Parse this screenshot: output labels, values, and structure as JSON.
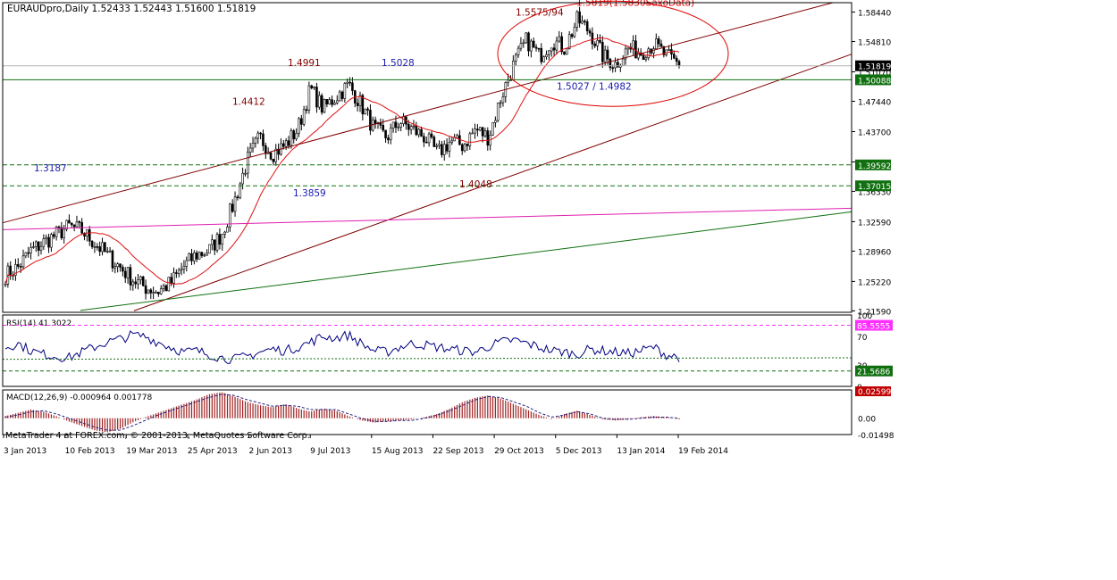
{
  "window": {
    "symbol_line": "EURAUDpro,Daily  1.52433 1.52443 1.51600 1.51819",
    "footer": "MetaTrader 4 at FOREX.com, © 2001-2013, MetaQuotes Software Corp."
  },
  "colors": {
    "background": "#ffffff",
    "candles": "#000000",
    "moving_average": "#e01010",
    "channel": "#800000",
    "pink_line": "#e020b0",
    "green_line": "#107010",
    "label_blue": "#1a1ab0",
    "label_dark_red": "#800000",
    "label_red": "#e00000",
    "badge_black": "#000000",
    "badge_green": "#107010",
    "badge_pink": "#ff30ff",
    "badge_red": "#c00000",
    "rsi_line": "#000080",
    "macd_hist": "#a02020"
  },
  "chart_data": [
    {
      "type": "candlestick",
      "panel": "price",
      "y_ticks": [
        "1.58440",
        "1.54810",
        "1.51070",
        "1.47440",
        "1.43700",
        "1.39960",
        "1.36330",
        "1.32590",
        "1.28960",
        "1.25220",
        "1.21590"
      ],
      "ylim": [
        1.2141,
        1.596
      ],
      "x_ticks": [
        "3 Jan 2013",
        "10 Feb 2013",
        "19 Mar 2013",
        "25 Apr 2013",
        "2 Jun 2013",
        "9 Jul 2013",
        "15 Aug 2013",
        "22 Sep 2013",
        "29 Oct 2013",
        "5 Dec 2013",
        "13 Jan 2014",
        "19 Feb 2014"
      ],
      "current_price": "1.51819",
      "price_badges": [
        {
          "label": "1.51819",
          "value": 1.51819,
          "style": "black"
        },
        {
          "label": "1.50088",
          "value": 1.50088,
          "style": "green"
        },
        {
          "label": "1.39592",
          "value": 1.39592,
          "style": "green"
        },
        {
          "label": "1.37015",
          "value": 1.37015,
          "style": "green"
        }
      ],
      "horizontal_levels": [
        {
          "value": 1.50088,
          "style": "solid"
        },
        {
          "value": 1.39592,
          "style": "dashed"
        },
        {
          "value": 1.37015,
          "style": "dashed"
        }
      ],
      "annotations": [
        {
          "text": "1.4991",
          "color": "dark_red"
        },
        {
          "text": "1.5028",
          "color": "blue"
        },
        {
          "text": "1.4412",
          "color": "dark_red"
        },
        {
          "text": "1.3187",
          "color": "blue"
        },
        {
          "text": "1.3859",
          "color": "blue"
        },
        {
          "text": "1.4048",
          "color": "dark_red"
        },
        {
          "text": "1.5575/94",
          "color": "dark_red"
        },
        {
          "text": "1.5819(1.5830SaxoData)",
          "color": "red"
        },
        {
          "text": "1.5027 / 1.4982",
          "color": "blue"
        }
      ],
      "close_trajectory": [
        1.26,
        1.27,
        1.29,
        1.3,
        1.31,
        1.32,
        1.315,
        1.3,
        1.285,
        1.27,
        1.255,
        1.245,
        1.24,
        1.25,
        1.27,
        1.285,
        1.29,
        1.31,
        1.35,
        1.4,
        1.43,
        1.41,
        1.42,
        1.44,
        1.49,
        1.465,
        1.48,
        1.495,
        1.47,
        1.44,
        1.43,
        1.45,
        1.44,
        1.43,
        1.41,
        1.425,
        1.42,
        1.44,
        1.43,
        1.48,
        1.52,
        1.55,
        1.53,
        1.55,
        1.54,
        1.575,
        1.56,
        1.53,
        1.52,
        1.54,
        1.535,
        1.545,
        1.53,
        1.52
      ]
    },
    {
      "type": "line",
      "panel": "rsi",
      "title": "RSI(14) 41.3022",
      "levels": [
        "85.5555",
        "21.5686"
      ],
      "level_values": [
        85.5555,
        21.5686
      ],
      "y_ticks": [
        "100",
        "70",
        "30",
        "0"
      ],
      "ylim": [
        0,
        100
      ],
      "values": [
        55,
        60,
        50,
        45,
        42,
        40,
        48,
        55,
        62,
        66,
        72,
        70,
        62,
        55,
        48,
        50,
        45,
        40,
        38,
        42,
        48,
        52,
        50,
        55,
        62,
        70,
        68,
        72,
        60,
        50,
        48,
        55,
        60,
        58,
        55,
        52,
        50,
        48,
        56,
        62,
        65,
        60,
        55,
        50,
        48,
        45,
        52,
        50,
        48,
        46,
        50,
        55,
        44,
        41
      ]
    },
    {
      "type": "bar",
      "panel": "macd",
      "title": "MACD(12,26,9) -0.000964 0.001778",
      "y_ticks": [
        "0.02599",
        "0.00",
        "-0.01498"
      ],
      "ylim": [
        -0.01498,
        0.02599
      ],
      "values": [
        0.002,
        0.005,
        0.008,
        0.006,
        0.002,
        -0.003,
        -0.007,
        -0.011,
        -0.013,
        -0.01,
        -0.004,
        0.001,
        0.005,
        0.009,
        0.013,
        0.017,
        0.022,
        0.024,
        0.02,
        0.015,
        0.012,
        0.01,
        0.013,
        0.009,
        0.006,
        0.009,
        0.007,
        0.002,
        -0.002,
        -0.004,
        -0.003,
        -0.002,
        -0.001,
        0.001,
        0.004,
        0.009,
        0.015,
        0.019,
        0.021,
        0.018,
        0.013,
        0.008,
        0.003,
        -0.001,
        0.004,
        0.007,
        0.003,
        -0.001,
        -0.002,
        -0.001,
        0.001,
        0.002,
        0.001,
        -0.001
      ],
      "signal": [
        0.001,
        0.003,
        0.006,
        0.007,
        0.004,
        0.0,
        -0.004,
        -0.008,
        -0.011,
        -0.011,
        -0.007,
        -0.002,
        0.003,
        0.007,
        0.011,
        0.015,
        0.019,
        0.022,
        0.021,
        0.017,
        0.014,
        0.011,
        0.012,
        0.011,
        0.008,
        0.008,
        0.008,
        0.004,
        0.0,
        -0.003,
        -0.003,
        -0.002,
        -0.002,
        0.0,
        0.003,
        0.007,
        0.012,
        0.017,
        0.02,
        0.019,
        0.015,
        0.011,
        0.005,
        0.001,
        0.003,
        0.006,
        0.004,
        0.0,
        -0.001,
        -0.001,
        0.0,
        0.001,
        0.001,
        0.0
      ]
    }
  ]
}
